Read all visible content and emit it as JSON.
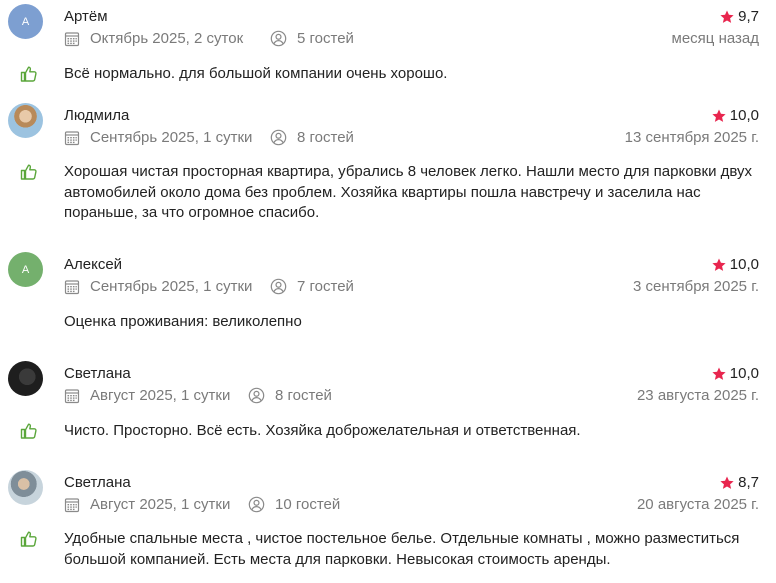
{
  "reviews": [
    {
      "avatar_letter": "А",
      "name": "Артём",
      "rating": "9,7",
      "period": "Октябрь 2025, 2 суток",
      "guests": "5 гостей",
      "date": "месяц назад",
      "text": "Всё нормально. для большой компании очень хорошо."
    },
    {
      "avatar_letter": "",
      "name": "Людмила",
      "rating": "10,0",
      "period": "Сентябрь 2025, 1 сутки",
      "guests": "8 гостей",
      "date": "13 сентября 2025 г.",
      "text": "Хорошая чистая просторная квартира, убрались 8 человек легко. Нашли место для парковки двух автомобилей около дома без проблем. Хозяйка квартиры пошла навстречу и заселила нас пораньше, за что огромное спасибо."
    },
    {
      "avatar_letter": "А",
      "name": "Алексей",
      "rating": "10,0",
      "period": "Сентябрь 2025, 1 сутки",
      "guests": "7 гостей",
      "date": "3 сентября 2025 г.",
      "text": "Оценка проживания: великолепно"
    },
    {
      "avatar_letter": "",
      "name": "Светлана",
      "rating": "10,0",
      "period": "Август 2025, 1 сутки",
      "guests": "8 гостей",
      "date": "23 августа 2025 г.",
      "text": "Чисто. Просторно. Всё есть. Хозяйка доброжелательная и ответственная."
    },
    {
      "avatar_letter": "",
      "name": "Светлана",
      "rating": "8,7",
      "period": "Август 2025, 1 сутки",
      "guests": "10 гостей",
      "date": "20 августа 2025 г.",
      "text": "Удобные спальные места , чистое постельное белье. Отдельные комнаты , можно разместиться большой компанией. Есть места для парковки. Невысокая стоимость аренды."
    }
  ],
  "colors": {
    "star": "#e8254e",
    "thumb": "#5aa63a",
    "muted": "#7a7a7a"
  },
  "icons": {
    "rating": "star-icon",
    "period": "calendar-icon",
    "guests": "user-icon",
    "recommend": "thumbs-up-icon"
  }
}
